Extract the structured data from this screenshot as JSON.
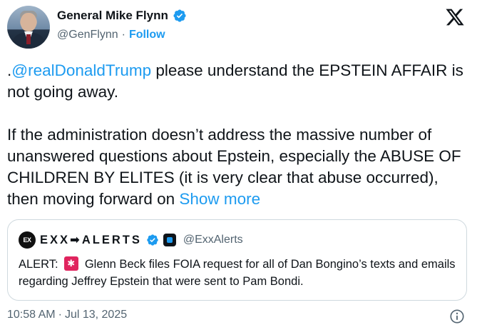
{
  "author": {
    "display_name": "General Mike Flynn",
    "handle": "@GenFlynn",
    "separator": "·",
    "follow_label": "Follow"
  },
  "tweet": {
    "prefix": ".",
    "mention": "@realDonaldTrump",
    "line1_rest": "  please understand the EPSTEIN AFFAIR is not going away.",
    "paragraph2": "If the administration doesn’t address the massive number of unanswered questions about Epstein, especially the ABUSE OF CHILDREN BY ELITES (it is very clear that abuse occurred), then moving forward on ",
    "show_more": "Show more"
  },
  "quote": {
    "avatar_text": "EX",
    "name": "EXX➡ALERTS",
    "handle": "@ExxAlerts",
    "text_prefix": "ALERT: ",
    "text_body": " Glenn Beck files FOIA request for all of Dan Bongino’s texts and emails regarding Jeffrey Epstein that were sent to Pam Bondi."
  },
  "footer": {
    "time": "10:58 AM",
    "separator": "·",
    "date": "Jul 13, 2025"
  },
  "icons": {
    "verified": "verified-badge-icon",
    "x_logo": "x-logo-icon",
    "info": "info-icon",
    "siren": "police-light-icon"
  },
  "colors": {
    "accent": "#1d9bf0",
    "secondary_text": "#536471",
    "border": "#cfd9de"
  }
}
